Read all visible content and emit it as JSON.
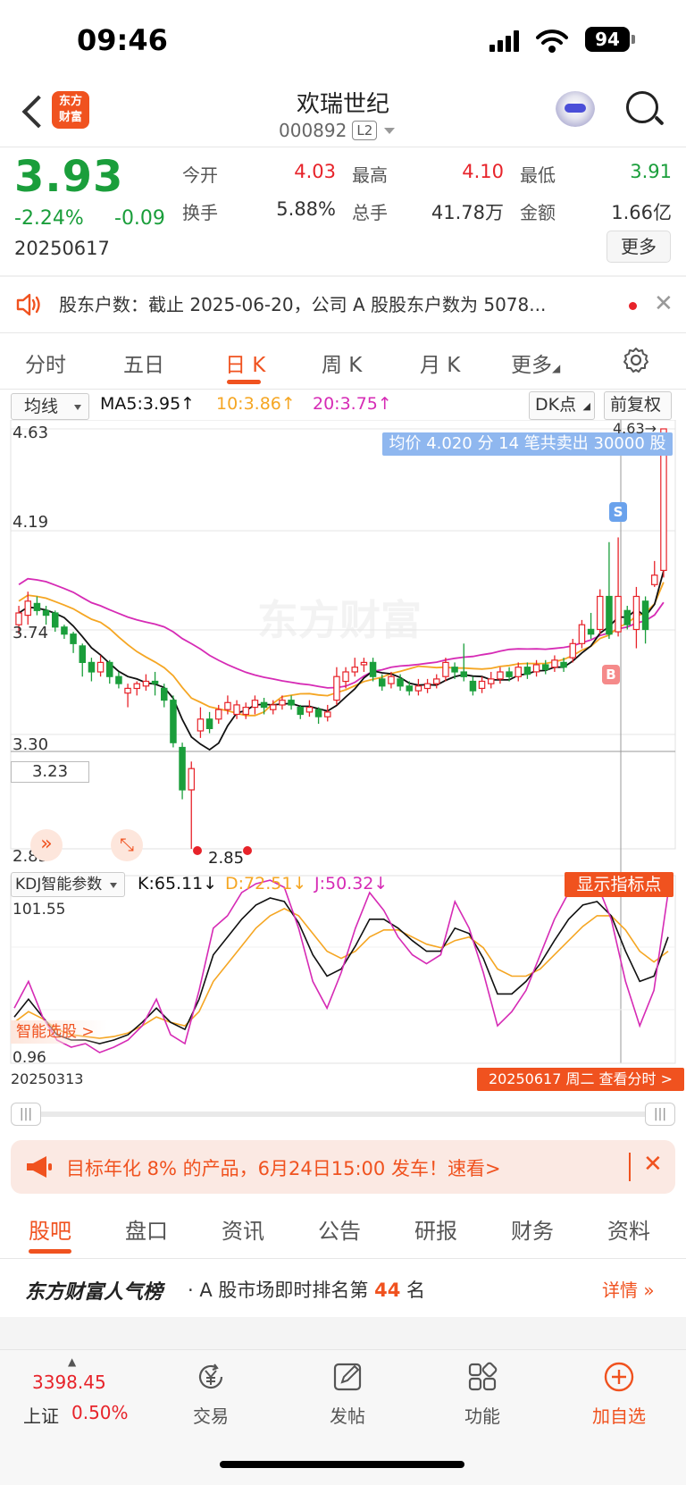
{
  "status_bar": {
    "time": "09:46",
    "battery": "94"
  },
  "header": {
    "stock_name": "欢瑞世纪",
    "stock_code": "000892",
    "level": "L2",
    "logo_text": "东方\n财富"
  },
  "quote": {
    "price": "3.93",
    "change_pct": "-2.24%",
    "change": "-0.09",
    "date": "20250617",
    "fields": [
      {
        "label": "今开",
        "value": "4.03",
        "color": "#e7232a"
      },
      {
        "label": "最高",
        "value": "4.10",
        "color": "#e7232a"
      },
      {
        "label": "最低",
        "value": "3.91",
        "color": "#1a9e3b"
      },
      {
        "label": "换手",
        "value": "5.88%",
        "color": "#333333"
      },
      {
        "label": "总手",
        "value": "41.78万",
        "color": "#333333"
      },
      {
        "label": "金额",
        "value": "1.66亿",
        "color": "#333333"
      }
    ],
    "more_label": "更多"
  },
  "notice": {
    "text": "股东户数：截止 2025-06-20，公司 A 股股东户数为 5078..."
  },
  "period_tabs": [
    "分时",
    "五日",
    "日 K",
    "周 K",
    "月 K",
    "更多"
  ],
  "active_tab": "日 K",
  "kline": {
    "indicator_select": "均线",
    "ma5": "MA5:3.95↑",
    "ma10": "10:3.86↑",
    "ma20": "20:3.75↑",
    "dk_label": "DK点",
    "adjust_label": "前复权",
    "price_ticks": [
      "4.63",
      "4.19",
      "3.74",
      "3.30",
      "2.85"
    ],
    "cursor_price": "3.23",
    "high_marker": "4.63→",
    "low_marker": "2.85",
    "tooltip": "均价 4.020 分 14 笔共卖出 30000 股",
    "watermark": "东方财富",
    "badge_s": "S",
    "badge_b": "B"
  },
  "kdj": {
    "select": "KDJ智能参数",
    "k": "K:65.11↓",
    "d": "D:72.51↓",
    "j": "J:50.32↓",
    "show_points": "显示指标点",
    "max": "101.55",
    "min": "0.96",
    "smart_pick": "智能选股 >"
  },
  "date_axis": {
    "start": "20250313",
    "end": "20250617 周二 查看分时 >"
  },
  "colors": {
    "up": "#e7232a",
    "down": "#1a9e3b",
    "accent": "#f0521f",
    "ma5": "#111111",
    "ma10": "#f5a623",
    "ma20": "#d62bb5"
  },
  "chart_data": {
    "type": "candlestick",
    "ylim": [
      2.85,
      4.63
    ],
    "candles": [
      {
        "o": 3.8,
        "c": 3.85,
        "h": 3.88,
        "l": 3.76
      },
      {
        "o": 3.84,
        "c": 3.9,
        "h": 3.94,
        "l": 3.8
      },
      {
        "o": 3.89,
        "c": 3.86,
        "h": 3.92,
        "l": 3.84
      },
      {
        "o": 3.86,
        "c": 3.84,
        "h": 3.88,
        "l": 3.8
      },
      {
        "o": 3.85,
        "c": 3.79,
        "h": 3.86,
        "l": 3.77
      },
      {
        "o": 3.79,
        "c": 3.76,
        "h": 3.8,
        "l": 3.74
      },
      {
        "o": 3.76,
        "c": 3.72,
        "h": 3.77,
        "l": 3.68
      },
      {
        "o": 3.71,
        "c": 3.64,
        "h": 3.72,
        "l": 3.58
      },
      {
        "o": 3.64,
        "c": 3.6,
        "h": 3.66,
        "l": 3.56
      },
      {
        "o": 3.6,
        "c": 3.64,
        "h": 3.67,
        "l": 3.58
      },
      {
        "o": 3.64,
        "c": 3.58,
        "h": 3.65,
        "l": 3.55
      },
      {
        "o": 3.58,
        "c": 3.55,
        "h": 3.6,
        "l": 3.53
      },
      {
        "o": 3.51,
        "c": 3.53,
        "h": 3.55,
        "l": 3.45
      },
      {
        "o": 3.53,
        "c": 3.55,
        "h": 3.56,
        "l": 3.5
      },
      {
        "o": 3.54,
        "c": 3.56,
        "h": 3.59,
        "l": 3.52
      },
      {
        "o": 3.56,
        "c": 3.55,
        "h": 3.6,
        "l": 3.5
      },
      {
        "o": 3.53,
        "c": 3.48,
        "h": 3.55,
        "l": 3.45
      },
      {
        "o": 3.48,
        "c": 3.3,
        "h": 3.5,
        "l": 3.28
      },
      {
        "o": 3.28,
        "c": 3.1,
        "h": 3.3,
        "l": 3.06
      },
      {
        "o": 3.1,
        "c": 3.19,
        "h": 3.22,
        "l": 2.85
      },
      {
        "o": 3.35,
        "c": 3.4,
        "h": 3.45,
        "l": 3.32
      },
      {
        "o": 3.4,
        "c": 3.36,
        "h": 3.43,
        "l": 3.34
      },
      {
        "o": 3.4,
        "c": 3.44,
        "h": 3.46,
        "l": 3.38
      },
      {
        "o": 3.44,
        "c": 3.47,
        "h": 3.5,
        "l": 3.42
      },
      {
        "o": 3.42,
        "c": 3.46,
        "h": 3.48,
        "l": 3.4
      },
      {
        "o": 3.42,
        "c": 3.45,
        "h": 3.47,
        "l": 3.4
      },
      {
        "o": 3.45,
        "c": 3.48,
        "h": 3.5,
        "l": 3.42
      },
      {
        "o": 3.47,
        "c": 3.45,
        "h": 3.49,
        "l": 3.42
      },
      {
        "o": 3.44,
        "c": 3.46,
        "h": 3.48,
        "l": 3.42
      },
      {
        "o": 3.46,
        "c": 3.48,
        "h": 3.5,
        "l": 3.44
      },
      {
        "o": 3.48,
        "c": 3.46,
        "h": 3.5,
        "l": 3.44
      },
      {
        "o": 3.45,
        "c": 3.42,
        "h": 3.46,
        "l": 3.4
      },
      {
        "o": 3.43,
        "c": 3.45,
        "h": 3.48,
        "l": 3.41
      },
      {
        "o": 3.44,
        "c": 3.41,
        "h": 3.45,
        "l": 3.38
      },
      {
        "o": 3.41,
        "c": 3.43,
        "h": 3.46,
        "l": 3.39
      },
      {
        "o": 3.48,
        "c": 3.58,
        "h": 3.62,
        "l": 3.46
      },
      {
        "o": 3.56,
        "c": 3.6,
        "h": 3.62,
        "l": 3.53
      },
      {
        "o": 3.6,
        "c": 3.62,
        "h": 3.66,
        "l": 3.58
      },
      {
        "o": 3.63,
        "c": 3.64,
        "h": 3.66,
        "l": 3.6
      },
      {
        "o": 3.64,
        "c": 3.58,
        "h": 3.66,
        "l": 3.56
      },
      {
        "o": 3.57,
        "c": 3.54,
        "h": 3.59,
        "l": 3.52
      },
      {
        "o": 3.55,
        "c": 3.58,
        "h": 3.6,
        "l": 3.53
      },
      {
        "o": 3.57,
        "c": 3.54,
        "h": 3.59,
        "l": 3.52
      },
      {
        "o": 3.54,
        "c": 3.52,
        "h": 3.56,
        "l": 3.5
      },
      {
        "o": 3.52,
        "c": 3.54,
        "h": 3.57,
        "l": 3.5
      },
      {
        "o": 3.53,
        "c": 3.55,
        "h": 3.57,
        "l": 3.51
      },
      {
        "o": 3.55,
        "c": 3.57,
        "h": 3.59,
        "l": 3.53
      },
      {
        "o": 3.58,
        "c": 3.64,
        "h": 3.66,
        "l": 3.56
      },
      {
        "o": 3.62,
        "c": 3.6,
        "h": 3.64,
        "l": 3.57
      },
      {
        "o": 3.6,
        "c": 3.58,
        "h": 3.72,
        "l": 3.56
      },
      {
        "o": 3.56,
        "c": 3.52,
        "h": 3.58,
        "l": 3.5
      },
      {
        "o": 3.53,
        "c": 3.56,
        "h": 3.58,
        "l": 3.51
      },
      {
        "o": 3.55,
        "c": 3.57,
        "h": 3.6,
        "l": 3.53
      },
      {
        "o": 3.57,
        "c": 3.6,
        "h": 3.62,
        "l": 3.55
      },
      {
        "o": 3.6,
        "c": 3.58,
        "h": 3.62,
        "l": 3.56
      },
      {
        "o": 3.58,
        "c": 3.62,
        "h": 3.64,
        "l": 3.56
      },
      {
        "o": 3.62,
        "c": 3.59,
        "h": 3.64,
        "l": 3.57
      },
      {
        "o": 3.6,
        "c": 3.63,
        "h": 3.65,
        "l": 3.58
      },
      {
        "o": 3.63,
        "c": 3.61,
        "h": 3.65,
        "l": 3.59
      },
      {
        "o": 3.62,
        "c": 3.65,
        "h": 3.67,
        "l": 3.6
      },
      {
        "o": 3.64,
        "c": 3.62,
        "h": 3.66,
        "l": 3.6
      },
      {
        "o": 3.66,
        "c": 3.72,
        "h": 3.74,
        "l": 3.64
      },
      {
        "o": 3.72,
        "c": 3.8,
        "h": 3.82,
        "l": 3.7
      },
      {
        "o": 3.78,
        "c": 3.76,
        "h": 3.85,
        "l": 3.74
      },
      {
        "o": 3.78,
        "c": 3.92,
        "h": 3.95,
        "l": 3.76
      },
      {
        "o": 3.92,
        "c": 3.76,
        "h": 4.15,
        "l": 3.74
      },
      {
        "o": 3.77,
        "c": 3.92,
        "h": 4.17,
        "l": 3.75
      },
      {
        "o": 3.86,
        "c": 3.8,
        "h": 3.88,
        "l": 3.78
      },
      {
        "o": 3.78,
        "c": 3.92,
        "h": 3.96,
        "l": 3.7
      },
      {
        "o": 3.9,
        "c": 3.78,
        "h": 3.92,
        "l": 3.72
      },
      {
        "o": 3.97,
        "c": 4.01,
        "h": 4.07,
        "l": 3.96
      },
      {
        "o": 4.03,
        "c": 4.63,
        "h": 4.63,
        "l": 4.0
      }
    ]
  }
}
